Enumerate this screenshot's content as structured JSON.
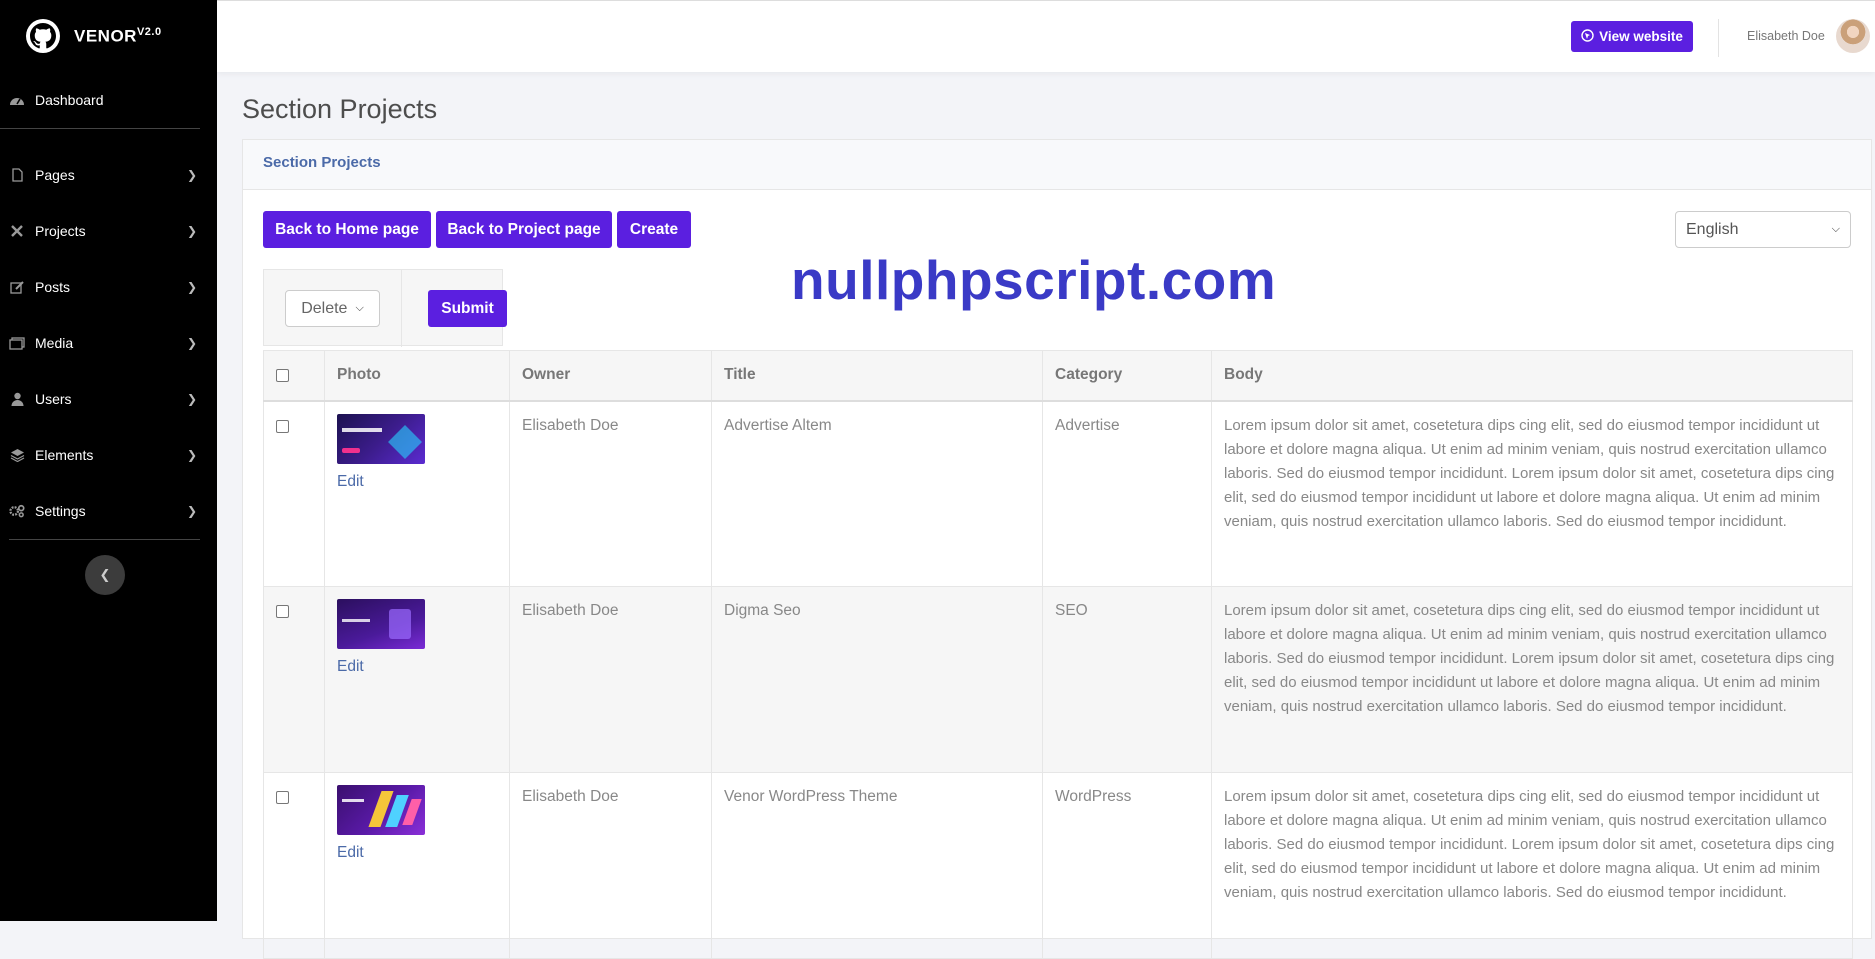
{
  "brand": {
    "name": "VENOR",
    "version": "V2.0"
  },
  "sidebar": {
    "items": [
      {
        "label": "Dashboard",
        "icon": "dashboard-icon"
      },
      {
        "label": "Pages",
        "icon": "file-icon"
      },
      {
        "label": "Projects",
        "icon": "tools-icon"
      },
      {
        "label": "Posts",
        "icon": "edit-icon"
      },
      {
        "label": "Media",
        "icon": "photo-icon"
      },
      {
        "label": "Users",
        "icon": "user-icon"
      },
      {
        "label": "Elements",
        "icon": "layers-icon"
      },
      {
        "label": "Settings",
        "icon": "gears-icon"
      }
    ]
  },
  "topbar": {
    "view_website": "View website",
    "user_name": "Elisabeth Doe"
  },
  "page": {
    "title": "Section Projects"
  },
  "card": {
    "header": "Section Projects",
    "buttons": {
      "back_home": "Back to Home page",
      "back_project": "Back to Project page",
      "create": "Create"
    },
    "language": "English",
    "bulk_action": "Delete",
    "submit": "Submit",
    "watermark": "nullphpscript.com"
  },
  "table": {
    "headers": [
      "Photo",
      "Owner",
      "Title",
      "Category",
      "Body"
    ],
    "edit_label": "Edit",
    "rows": [
      {
        "owner": "Elisabeth Doe",
        "title": "Advertise Altem",
        "category": "Advertise",
        "body": "Lorem ipsum dolor sit amet, cosetetura dips cing elit, sed do eiusmod tempor incididunt ut labore et dolore magna aliqua. Ut enim ad minim veniam, quis nostrud exercitation ullamco laboris. Sed do eiusmod tempor incididunt. Lorem ipsum dolor sit amet, cosetetura dips cing elit, sed do eiusmod tempor incididunt ut labore et dolore magna aliqua. Ut enim ad minim veniam, quis nostrud exercitation ullamco laboris. Sed do eiusmod tempor incididunt."
      },
      {
        "owner": "Elisabeth Doe",
        "title": "Digma Seo",
        "category": "SEO",
        "body": "Lorem ipsum dolor sit amet, cosetetura dips cing elit, sed do eiusmod tempor incididunt ut labore et dolore magna aliqua. Ut enim ad minim veniam, quis nostrud exercitation ullamco laboris. Sed do eiusmod tempor incididunt. Lorem ipsum dolor sit amet, cosetetura dips cing elit, sed do eiusmod tempor incididunt ut labore et dolore magna aliqua. Ut enim ad minim veniam, quis nostrud exercitation ullamco laboris. Sed do eiusmod tempor incididunt."
      },
      {
        "owner": "Elisabeth Doe",
        "title": "Venor WordPress Theme",
        "category": "WordPress",
        "body": "Lorem ipsum dolor sit amet, cosetetura dips cing elit, sed do eiusmod tempor incididunt ut labore et dolore magna aliqua. Ut enim ad minim veniam, quis nostrud exercitation ullamco laboris. Sed do eiusmod tempor incididunt. Lorem ipsum dolor sit amet, cosetetura dips cing elit, sed do eiusmod tempor incididunt ut labore et dolore magna aliqua. Ut enim ad minim veniam, quis nostrud exercitation ullamco laboris. Sed do eiusmod tempor incididunt."
      }
    ]
  },
  "colors": {
    "primary": "#5b1fe0",
    "sidebar_bg": "#000000",
    "link": "#4b6aa8",
    "watermark": "#3a3ac6"
  }
}
